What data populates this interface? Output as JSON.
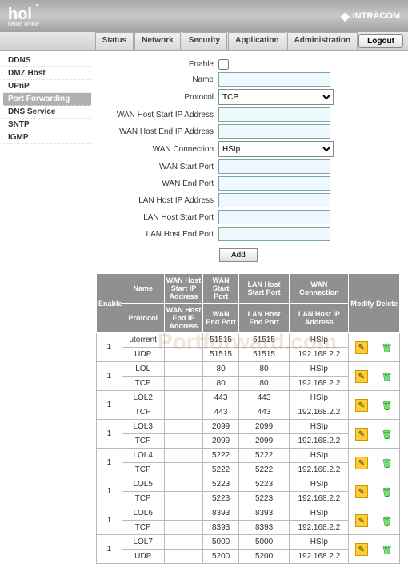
{
  "header": {
    "logo": "hol",
    "logo_sub": "hellas online",
    "brand": "INTRACOM"
  },
  "nav": {
    "tabs": [
      "Status",
      "Network",
      "Security",
      "Application",
      "Administration"
    ],
    "logout": "Logout"
  },
  "sidebar": {
    "items": [
      "DDNS",
      "DMZ Host",
      "UPnP",
      "Port Forwarding",
      "DNS Service",
      "SNTP",
      "IGMP"
    ],
    "active_index": 3
  },
  "form": {
    "enable_label": "Enable",
    "name_label": "Name",
    "name_value": "",
    "protocol_label": "Protocol",
    "protocol_value": "TCP",
    "wan_host_start_label": "WAN Host Start IP Address",
    "wan_host_start_value": "",
    "wan_host_end_label": "WAN Host End IP Address",
    "wan_host_end_value": "",
    "wan_conn_label": "WAN Connection",
    "wan_conn_value": "HSIp",
    "wan_start_port_label": "WAN Start Port",
    "wan_start_port_value": "",
    "wan_end_port_label": "WAN End Port",
    "wan_end_port_value": "",
    "lan_host_ip_label": "LAN Host IP Address",
    "lan_host_ip_value": "",
    "lan_start_port_label": "LAN Host Start Port",
    "lan_start_port_value": "",
    "lan_end_port_label": "LAN Host End Port",
    "lan_end_port_value": "",
    "add_label": "Add"
  },
  "table": {
    "headers": {
      "enable": "Enable",
      "name": "Name",
      "protocol": "Protocol",
      "wan_host_start": "WAN Host Start IP Address",
      "wan_host_end": "WAN Host End IP Address",
      "wan_start_port": "WAN Start Port",
      "wan_end_port": "WAN End Port",
      "lan_start_port": "LAN Host Start Port",
      "lan_end_port": "LAN Host End Port",
      "wan_conn": "WAN Connection",
      "lan_host_ip": "LAN Host IP Address",
      "modify": "Modify",
      "delete": "Delete"
    },
    "rows": [
      {
        "enable": "1",
        "name": "utorrent",
        "protocol": "UDP",
        "whs": "",
        "whe": "",
        "wsp": "51515",
        "wep": "51515",
        "lsp": "51515",
        "lep": "51515",
        "wc": "HSIp",
        "lhi": "192.168.2.2"
      },
      {
        "enable": "1",
        "name": "LOL",
        "protocol": "TCP",
        "whs": "",
        "whe": "",
        "wsp": "80",
        "wep": "80",
        "lsp": "80",
        "lep": "80",
        "wc": "HSIp",
        "lhi": "192.168.2.2"
      },
      {
        "enable": "1",
        "name": "LOL2",
        "protocol": "TCP",
        "whs": "",
        "whe": "",
        "wsp": "443",
        "wep": "443",
        "lsp": "443",
        "lep": "443",
        "wc": "HSIp",
        "lhi": "192.168.2.2"
      },
      {
        "enable": "1",
        "name": "LOL3",
        "protocol": "TCP",
        "whs": "",
        "whe": "",
        "wsp": "2099",
        "wep": "2099",
        "lsp": "2099",
        "lep": "2099",
        "wc": "HSIp",
        "lhi": "192.168.2.2"
      },
      {
        "enable": "1",
        "name": "LOL4",
        "protocol": "TCP",
        "whs": "",
        "whe": "",
        "wsp": "5222",
        "wep": "5222",
        "lsp": "5222",
        "lep": "5222",
        "wc": "HSIp",
        "lhi": "192.168.2.2"
      },
      {
        "enable": "1",
        "name": "LOL5",
        "protocol": "TCP",
        "whs": "",
        "whe": "",
        "wsp": "5223",
        "wep": "5223",
        "lsp": "5223",
        "lep": "5223",
        "wc": "HSIp",
        "lhi": "192.168.2.2"
      },
      {
        "enable": "1",
        "name": "LOL6",
        "protocol": "TCP",
        "whs": "",
        "whe": "",
        "wsp": "8393",
        "wep": "8393",
        "lsp": "8393",
        "lep": "8393",
        "wc": "HSIp",
        "lhi": "192.168.2.2"
      },
      {
        "enable": "1",
        "name": "LOL7",
        "protocol": "UDP",
        "whs": "",
        "whe": "",
        "wsp": "5000",
        "wep": "5200",
        "lsp": "5000",
        "lep": "5200",
        "wc": "HSIp",
        "lhi": "192.168.2.2"
      }
    ]
  },
  "watermark": "Portforward.com"
}
